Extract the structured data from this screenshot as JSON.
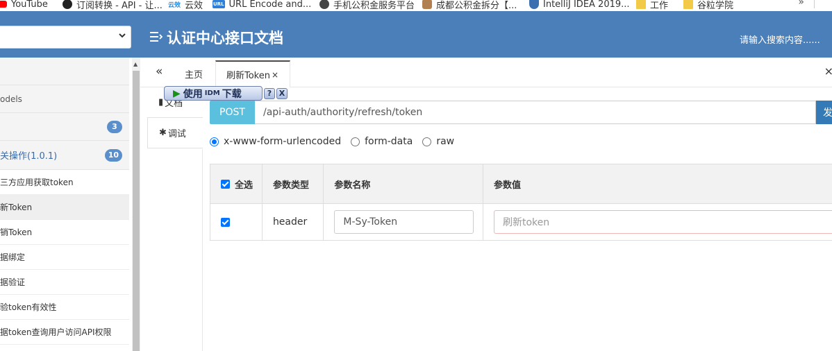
{
  "bookmarks": [
    {
      "label": "YouTube",
      "icon": "youtube-icon",
      "color": "#ff0000"
    },
    {
      "label": "订阅转换 - API - 让...",
      "icon": "github-icon",
      "color": "#222222"
    },
    {
      "label": "云效",
      "icon": "yunxiao-logo",
      "color": "#1e88e5",
      "logo_text": "云效"
    },
    {
      "label": "URL Encode and...",
      "icon": "url-icon",
      "color": "#2f7fd8",
      "logo_text": "URL"
    },
    {
      "label": "手机公积金服务平台",
      "icon": "globe-icon",
      "color": "#444444"
    },
    {
      "label": "成都公积金拆分【...",
      "icon": "avatar-icon",
      "color": "#b08050"
    },
    {
      "label": "IntelliJ IDEA 2019...",
      "icon": "shield-icon",
      "color": "#3a6fb0"
    },
    {
      "label": "工作",
      "icon": "folder-icon",
      "color": "#f3c948"
    },
    {
      "label": "谷粒学院",
      "icon": "folder-icon",
      "color": "#f3c948"
    }
  ],
  "bookmarks_more": "»",
  "header": {
    "title": "认证中心接口文档",
    "search_placeholder": "请输入搜索内容......",
    "bg_color": "#4a7fba"
  },
  "sidebar": {
    "rows": [
      {
        "label": "",
        "badge": null,
        "kind": "plain"
      },
      {
        "label": "odels",
        "badge": null,
        "kind": "plain"
      },
      {
        "label": "",
        "badge": "3",
        "kind": "plain"
      },
      {
        "label": "关操作(1.0.1)",
        "badge": "10",
        "kind": "group"
      },
      {
        "label": "三方应用获取token",
        "badge": null,
        "kind": "sub"
      },
      {
        "label": "新Token",
        "badge": null,
        "kind": "sub-active"
      },
      {
        "label": "销Token",
        "badge": null,
        "kind": "sub"
      },
      {
        "label": "据绑定",
        "badge": null,
        "kind": "sub"
      },
      {
        "label": "据验证",
        "badge": null,
        "kind": "sub"
      },
      {
        "label": "验token有效性",
        "badge": null,
        "kind": "sub"
      },
      {
        "label": "据token查询用户访问API权限",
        "badge": null,
        "kind": "sub"
      }
    ]
  },
  "tabs": {
    "nav_icon": "«",
    "home": "主页",
    "active": "刷新Token",
    "close": "×",
    "close_all": "×"
  },
  "subtabs": {
    "docs": "文档",
    "debug": "调试"
  },
  "idm": {
    "label_a": "使用",
    "label_b": "IDM",
    "label_c": "下载",
    "help": "?",
    "close": "X"
  },
  "request": {
    "method": "POST",
    "url": "/api-auth/authority/refresh/token",
    "send": "发"
  },
  "content_types": [
    {
      "label": "x-www-form-urlencoded",
      "selected": true
    },
    {
      "label": "form-data",
      "selected": false
    },
    {
      "label": "raw",
      "selected": false
    }
  ],
  "params": {
    "headers": [
      "全选",
      "参数类型",
      "参数名称",
      "参数值"
    ],
    "rows": [
      {
        "checked": true,
        "type": "header",
        "name": "M-Sy-Token",
        "value_placeholder": "刷新token"
      }
    ]
  }
}
